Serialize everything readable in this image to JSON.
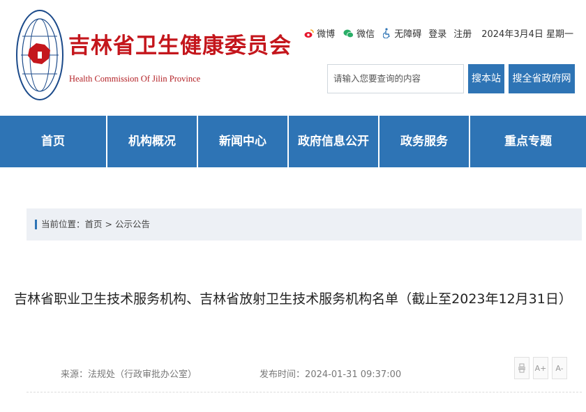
{
  "header": {
    "org_name_cn": "吉林省卫生健康委员会",
    "org_name_en": "Health Commission Of Jilin Province",
    "emblem_icon": "jilin-health-emblem"
  },
  "toplinks": {
    "weibo": "微博",
    "wechat": "微信",
    "accessibility": "无障碍",
    "login": "登录",
    "register": "注册",
    "date": "2024年3月4日 星期一"
  },
  "search": {
    "placeholder": "请输入您要查询的内容",
    "btn_site": "搜本站",
    "btn_all": "搜全省政府网站"
  },
  "nav": {
    "items": [
      "首页",
      "机构概况",
      "新闻中心",
      "政府信息公开",
      "政务服务",
      "重点专题"
    ]
  },
  "breadcrumb": {
    "prefix": "当前位置：",
    "home": "首页",
    "sep": " > ",
    "current": "公示公告"
  },
  "article": {
    "title": "吉林省职业卫生技术服务机构、吉林省放射卫生技术服务机构名单（截止至2023年12月31日）",
    "source_label": "来源：",
    "source": "法规处（行政审批办公室）",
    "time_label": "发布时间：",
    "time": "2024-01-31 09:37:00"
  },
  "tools": {
    "print_icon": "print-icon",
    "font_larger": "A+",
    "font_smaller": "A-"
  },
  "colors": {
    "brand_red": "#c4161c",
    "nav_blue": "#2e74b5",
    "crumb_bg": "#edf0f5"
  }
}
